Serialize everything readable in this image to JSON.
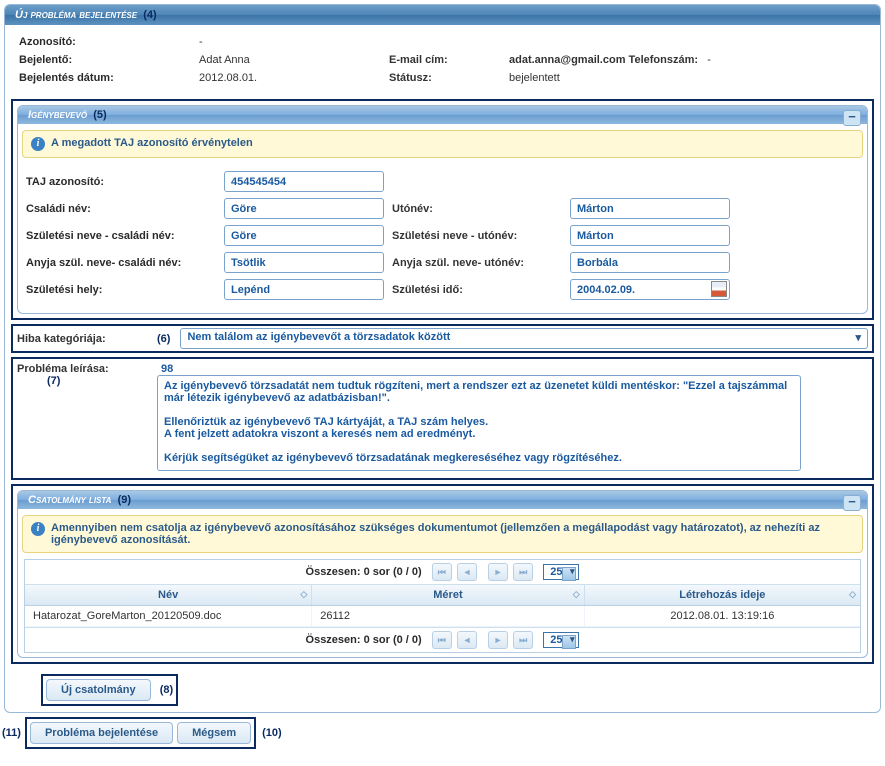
{
  "mainPanel": {
    "title": "Új probléma bejelentése",
    "tag": "(4)"
  },
  "header": {
    "id_label": "Azonosító:",
    "id_val": "-",
    "reporter_label": "Bejelentő:",
    "reporter_val": "Adat Anna",
    "email_label": "E-mail cím:",
    "email_val": "adat.anna@gmail.com",
    "phone_label": "Telefonszám:",
    "phone_val": "-",
    "date_label": "Bejelentés dátum:",
    "date_val": "2012.08.01.",
    "status_label": "Státusz:",
    "status_val": "bejelentett"
  },
  "claimant": {
    "title": "Igénybevevő",
    "tag": "(5)",
    "warning": "A megadott TAJ azonosító érvénytelen",
    "taj_label": "TAJ azonosító:",
    "taj_val": "454545454",
    "family_label": "Családi név:",
    "family_val": "Göre",
    "given_label": "Utónév:",
    "given_val": "Márton",
    "bfamily_label": "Születési neve - családi név:",
    "bfamily_val": "Göre",
    "bgiven_label": "Születési neve - utónév:",
    "bgiven_val": "Márton",
    "mfamily_label": "Anyja szül. neve- családi név:",
    "mfamily_val": "Tsötlik",
    "mgiven_label": "Anyja szül. neve- utónév:",
    "mgiven_val": "Borbála",
    "bplace_label": "Születési hely:",
    "bplace_val": "Lepénd",
    "bdate_label": "Születési idő:",
    "bdate_val": "2004.02.09."
  },
  "category": {
    "label": "Hiba kategóriája:",
    "tag": "(6)",
    "value": "Nem találom az igénybevevőt a törzsadatok között"
  },
  "desc": {
    "label": "Probléma leírása:",
    "tag": "(7)",
    "counter": "98",
    "text": "Az igénybevevő törzsadatát nem tudtuk rögzíteni, mert a rendszer ezt az üzenetet küldi mentéskor: \"Ezzel a tajszámmal már létezik igénybevevő az adatbázisban!\".\n\nEllenőriztük az igénybevevő TAJ kártyáját, a TAJ szám helyes.\nA fent jelzett adatokra viszont a keresés nem ad eredményt.\n\nKérjük segítségüket az igénybevevő törzsadatának megkereséséhez vagy rögzítéséhez."
  },
  "attach": {
    "title": "Csatolmány lista",
    "tag": "(9)",
    "warning": "Amennyiben nem csatolja az igénybevevő azonosításához szükséges dokumentumot (jellemzően a megállapodást vagy határozatot), az nehezíti az igénybevevő azonosítását.",
    "pager_text": "Összesen: 0 sor (0 / 0)",
    "page_size": "25",
    "col1": "Név",
    "col2": "Méret",
    "col3": "Létrehozás ideje",
    "row_name": "Hatarozat_GoreMarton_20120509.doc",
    "row_size": "26112",
    "row_date": "2012.08.01. 13:19:16"
  },
  "buttons": {
    "new_attach": "Új csatolmány",
    "new_attach_tag": "(8)",
    "submit": "Probléma bejelentése",
    "submit_tag": "(11)",
    "cancel": "Mégsem",
    "cancel_tag": "(10)"
  }
}
